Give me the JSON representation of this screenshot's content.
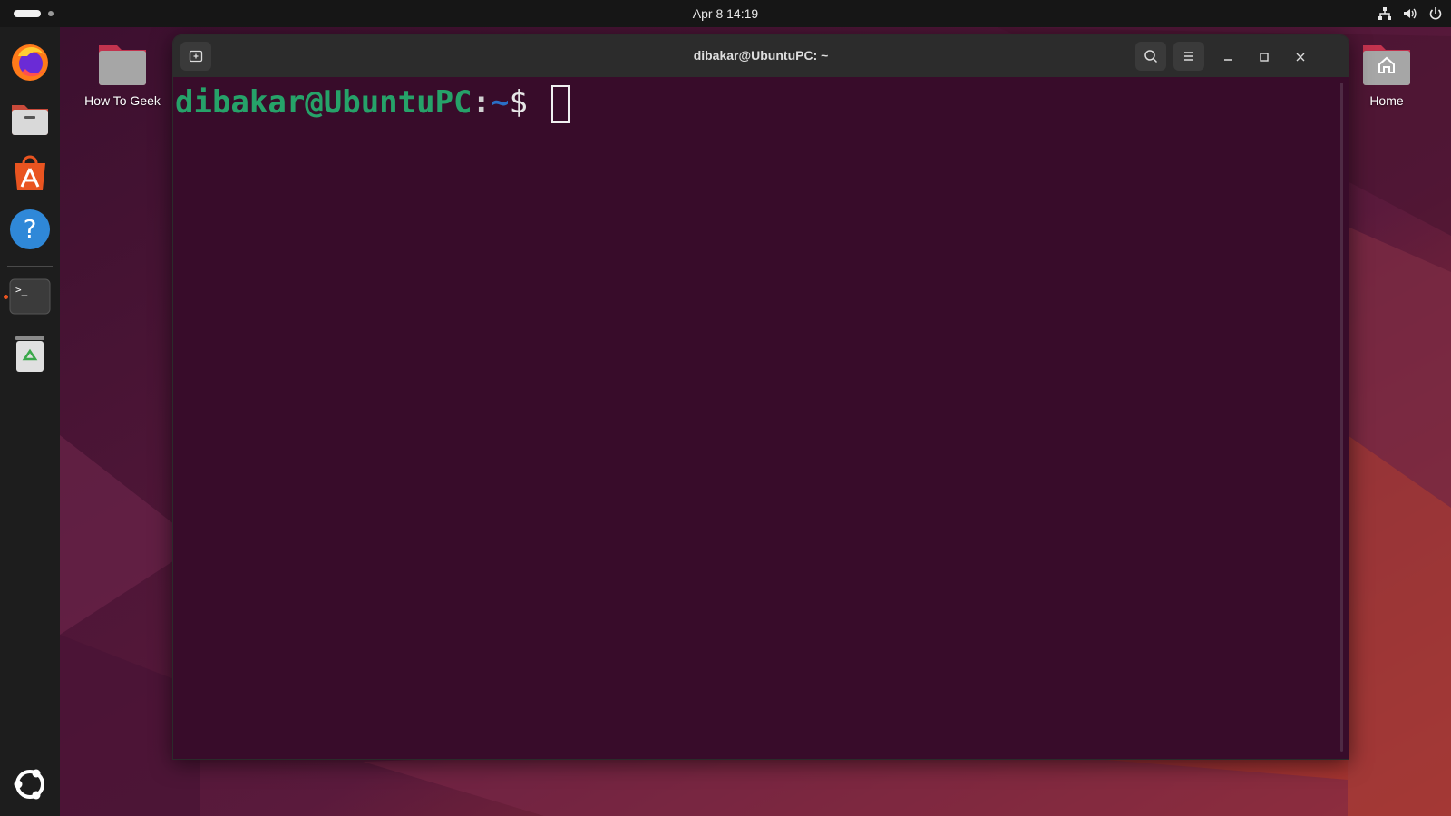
{
  "topbar": {
    "clock": "Apr 8  14:19",
    "tray_icons": [
      "network-icon",
      "volume-icon",
      "power-icon"
    ]
  },
  "dock": {
    "apps": [
      {
        "name": "Firefox",
        "icon": "firefox-icon"
      },
      {
        "name": "Files",
        "icon": "files-icon"
      },
      {
        "name": "App Center",
        "icon": "app-store-icon"
      },
      {
        "name": "Help",
        "icon": "help-icon"
      },
      {
        "name": "Terminal",
        "icon": "terminal-icon",
        "running": true
      },
      {
        "name": "Trash",
        "icon": "trash-icon"
      }
    ],
    "show_apps_icon": "ubuntu-logo-icon",
    "terminal_glyph": ">_",
    "help_glyph": "?"
  },
  "desktop": {
    "icons": [
      {
        "label": "How To Geek",
        "icon": "folder-icon"
      },
      {
        "label": "Home",
        "icon": "home-folder-icon"
      }
    ]
  },
  "terminal": {
    "title": "dibakar@UbuntuPC: ~",
    "prompt_user": "dibakar@UbuntuPC",
    "prompt_colon": ":",
    "prompt_path": "~",
    "prompt_symbol": "$",
    "colors": {
      "background": "#380c2a",
      "user": "#26a269",
      "path": "#2a6fc6",
      "titlebar": "#2c2c2c"
    }
  }
}
